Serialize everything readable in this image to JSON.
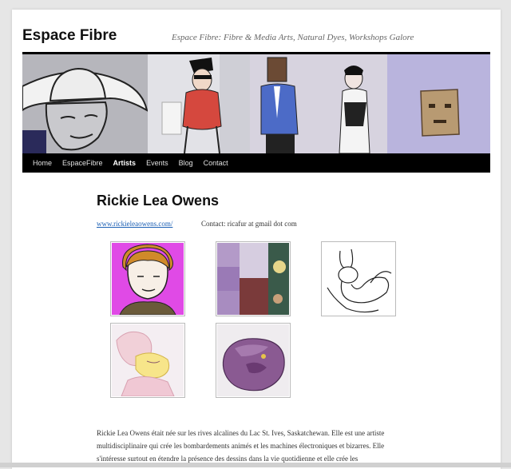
{
  "header": {
    "site_title": "Espace Fibre",
    "tagline": "Espace Fibre: Fibre & Media Arts, Natural Dyes, Workshops Galore"
  },
  "nav": {
    "items": [
      {
        "label": "Home"
      },
      {
        "label": "EspaceFibre"
      },
      {
        "label": "Artists",
        "active": true
      },
      {
        "label": "Events"
      },
      {
        "label": "Blog"
      },
      {
        "label": "Contact"
      }
    ]
  },
  "entry": {
    "title": "Rickie Lea Owens",
    "website": "www.rickieleaowens.com/",
    "contact": "Contact: ricafur at gmail dot com",
    "bio": "Rickie Lea Owens était née sur les rives alcalines du Lac St. Ives, Saskatchewan. Elle est une artiste multidisciplinaire qui crée les bombardements animés et les machines électroniques et bizarres. Elle s'intéresse surtout en étendre la présence des dessins dans la vie quotidienne et elle crée les"
  },
  "colors": {
    "accent": "#1b5fb4",
    "nav_bg": "#000000",
    "thumb1_bg": "#e04ae6",
    "banner_panel4": "#b7b2dc"
  }
}
